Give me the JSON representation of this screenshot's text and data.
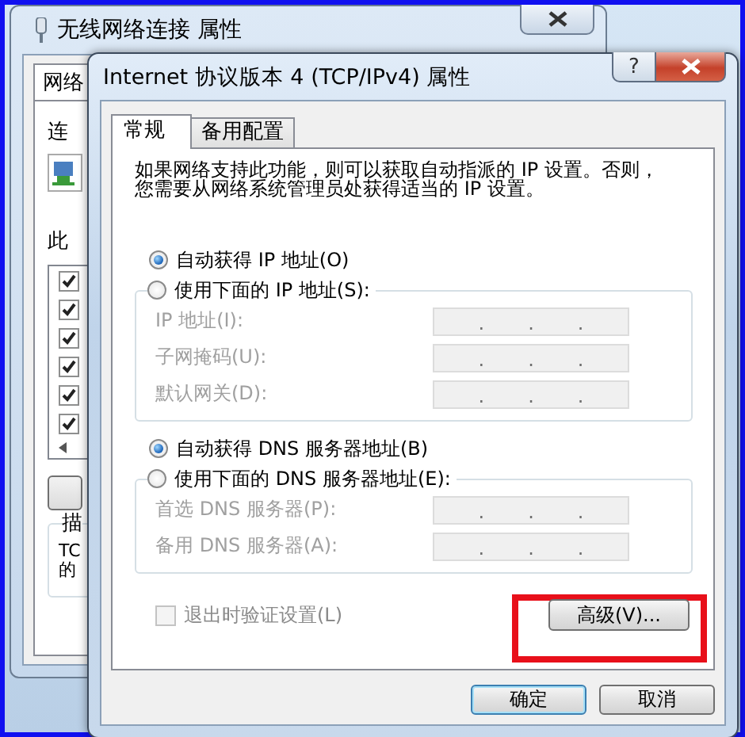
{
  "background_window": {
    "title": "无线网络连接 属性",
    "tab": "网络",
    "label_1": "连",
    "label_2": "此",
    "items": [
      {
        "checked": true
      },
      {
        "checked": true
      },
      {
        "checked": true
      },
      {
        "checked": true
      },
      {
        "checked": true
      },
      {
        "checked": true
      }
    ],
    "group_label": "描",
    "text_1": "TC",
    "text_2": "的"
  },
  "dialog": {
    "title": "Internet 协议版本 4 (TCP/IPv4) 属性",
    "help": "?",
    "tabs": [
      {
        "label": "常规",
        "selected": true
      },
      {
        "label": "备用配置",
        "selected": false
      }
    ],
    "description": [
      "如果网络支持此功能，则可以获取自动指派的 IP 设置。否则，",
      "您需要从网络系统管理员处获得适当的 IP 设置。"
    ],
    "ip_section": {
      "auto_option": {
        "label": "自动获得 IP 地址(O)",
        "selected": true
      },
      "manual_option": {
        "label": "使用下面的 IP 地址(S):",
        "selected": false
      },
      "fields": [
        {
          "label": "IP 地址(I):",
          "disabled": true,
          "separators": [
            ".",
            ".",
            "."
          ]
        },
        {
          "label": "子网掩码(U):",
          "disabled": true,
          "separators": [
            ".",
            ".",
            "."
          ]
        },
        {
          "label": "默认网关(D):",
          "disabled": true,
          "separators": [
            ".",
            ".",
            "."
          ]
        }
      ]
    },
    "dns_section": {
      "auto_option": {
        "label": "自动获得 DNS 服务器地址(B)",
        "selected": true
      },
      "manual_option": {
        "label": "使用下面的 DNS 服务器地址(E):",
        "selected": false
      },
      "fields": [
        {
          "label": "首选 DNS 服务器(P):",
          "disabled": true,
          "separators": [
            ".",
            ".",
            "."
          ]
        },
        {
          "label": "备用 DNS 服务器(A):",
          "disabled": true,
          "separators": [
            ".",
            ".",
            "."
          ]
        }
      ]
    },
    "validate_checkbox": {
      "label": "退出时验证设置(L)",
      "checked": false,
      "disabled": true
    },
    "advanced_button": "高级(V)...",
    "buttons": [
      "确定",
      "取消"
    ]
  }
}
